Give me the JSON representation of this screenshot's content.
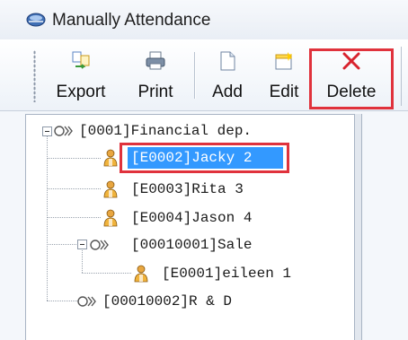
{
  "window": {
    "title": "Manually Attendance"
  },
  "toolbar": {
    "buttons": [
      {
        "id": "export",
        "label": "Export",
        "icon": "export-icon"
      },
      {
        "id": "print",
        "label": "Print",
        "icon": "printer-icon"
      },
      {
        "id": "add",
        "label": "Add",
        "icon": "new-document-icon"
      },
      {
        "id": "edit",
        "label": "Edit",
        "icon": "edit-document-icon"
      },
      {
        "id": "delete",
        "label": "Delete",
        "icon": "delete-x-icon"
      }
    ]
  },
  "tree": {
    "nodes": [
      {
        "label": "[0001]Financial dep.",
        "type": "department",
        "level": 0,
        "expanded": true
      },
      {
        "label": "[E0002]Jacky  2",
        "type": "employee",
        "level": 1,
        "selected": true
      },
      {
        "label": "[E0003]Rita  3",
        "type": "employee",
        "level": 1
      },
      {
        "label": "[E0004]Jason  4",
        "type": "employee",
        "level": 1
      },
      {
        "label": "[00010001]Sale",
        "type": "department",
        "level": 1,
        "expanded": true
      },
      {
        "label": "[E0001]eileen  1",
        "type": "employee",
        "level": 2
      },
      {
        "label": "[00010002]R & D",
        "type": "department",
        "level": 1
      }
    ]
  },
  "colors": {
    "highlight_box": "#e0323c",
    "selection": "#3399ff",
    "selection_text": "#ffffff"
  }
}
